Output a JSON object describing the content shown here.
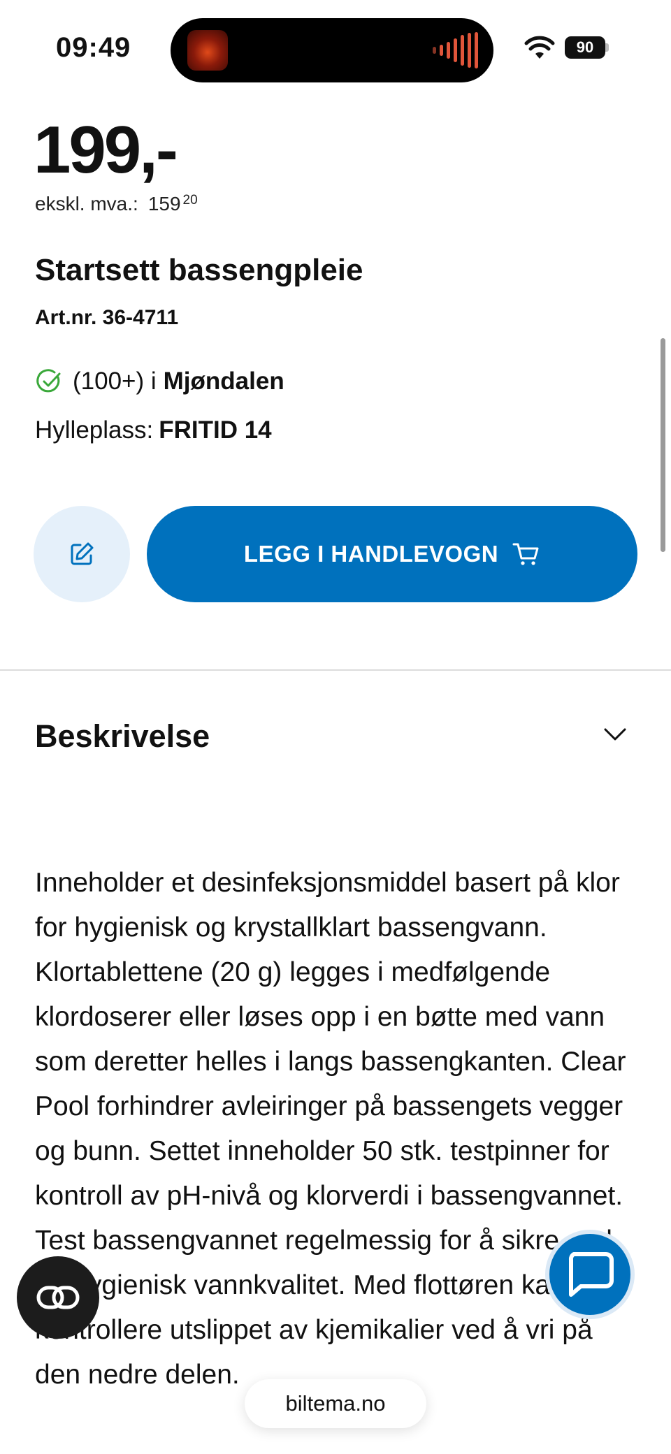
{
  "status_bar": {
    "time": "09:49",
    "battery": "90",
    "wifi_icon": "wifi-icon"
  },
  "product": {
    "price": "199,-",
    "vat_label": "ekskl. mva.:",
    "vat_value": "159",
    "vat_decimals": "20",
    "title": "Startsett bassengpleie",
    "article_number": "Art.nr. 36-4711",
    "stock_count": "(100+) i",
    "stock_store": "Mjøndalen",
    "shelf_label": "Hylleplass:",
    "shelf_value": "FRITID 14"
  },
  "actions": {
    "note_icon": "edit-note-icon",
    "add_to_cart_label": "LEGG I HANDLEVOGN",
    "cart_icon": "shopping-cart-icon"
  },
  "description": {
    "title": "Beskrivelse",
    "chevron_icon": "chevron-down-icon",
    "text": "Inneholder et desinfeksjonsmiddel basert på klor for hygienisk og krystallklart bassengvann. Klortablettene (20 g) legges i medfølgende klordoserer eller løses opp i en bøtte med vann som deretter helles i langs bassengkanten. Clear Pool forhindrer avleiringer på bassengets vegger og bunn. Settet inneholder 50 stk. testpinner for kontroll av pH-nivå og klorverdi i bassengvannet. Test bassengvannet regelmessig for å sikre god og hygienisk vannkvalitet. Med flottøren kan du kontrollere utslippet av kjemikalier ved å vri på den nedre delen."
  },
  "floating": {
    "chat_icon": "chat-bubble-icon",
    "link_icon": "link-icon",
    "url": "biltema.no"
  },
  "colors": {
    "brand_blue": "#0071bd",
    "note_button_bg": "#e5f0fa",
    "stock_green": "#3aa83a"
  }
}
